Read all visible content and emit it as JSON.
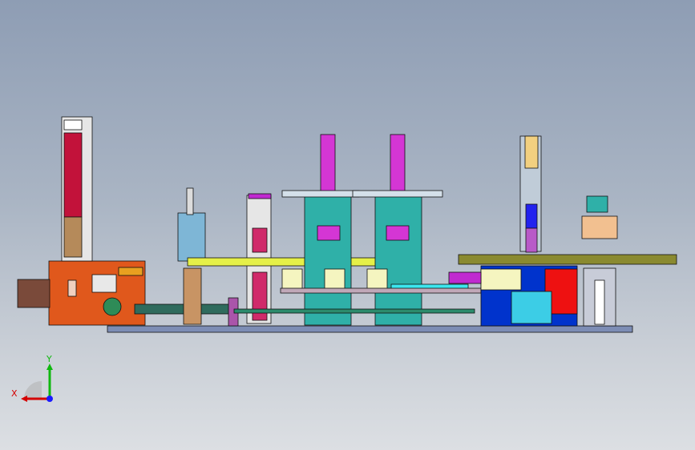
{
  "viewport": {
    "background_top": "#8e9db4",
    "background_bottom": "#dcdfe3"
  },
  "triad": {
    "x_label": "X",
    "y_label": "Y",
    "x_color": "#d40000",
    "y_color": "#0fb80f",
    "z_color": "#1a1aff"
  }
}
